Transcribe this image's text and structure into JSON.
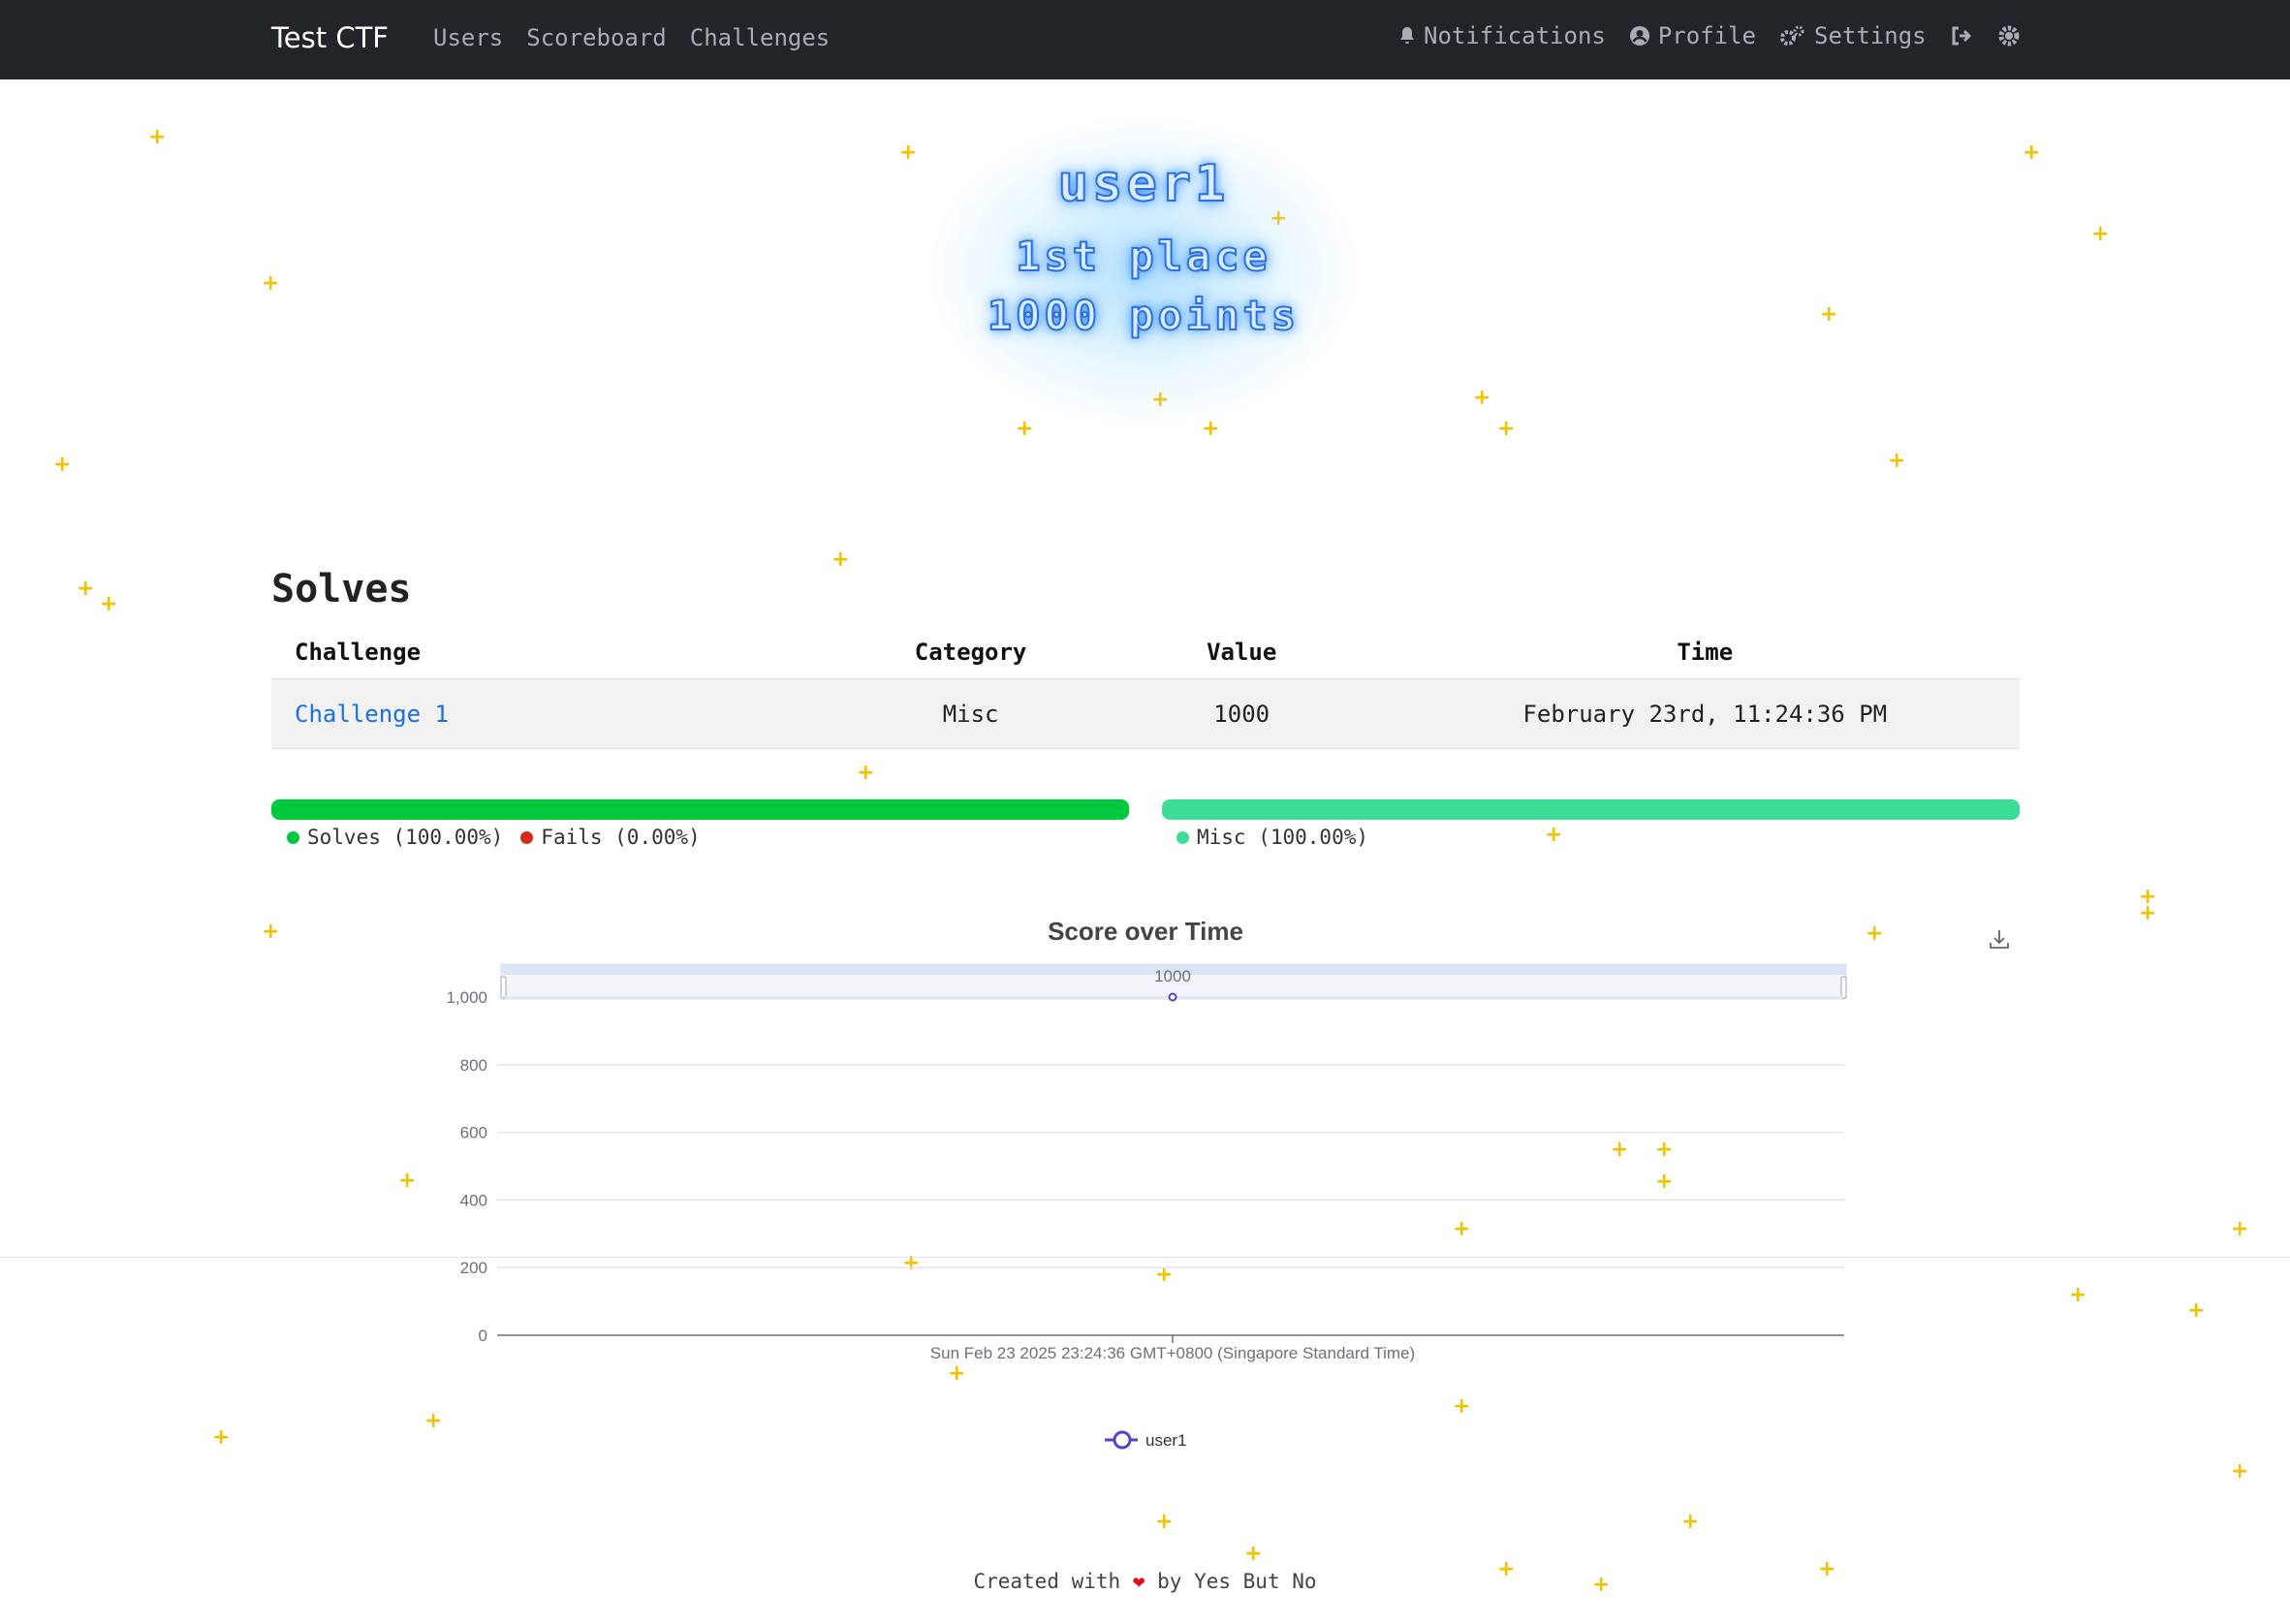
{
  "navbar": {
    "brand": "Test CTF",
    "links": [
      "Users",
      "Scoreboard",
      "Challenges"
    ],
    "right": {
      "notifications": "Notifications",
      "profile": "Profile",
      "settings": "Settings"
    }
  },
  "user": {
    "name": "user1",
    "place": "1st place",
    "points": "1000 points"
  },
  "solves": {
    "title": "Solves",
    "columns": [
      "Challenge",
      "Category",
      "Value",
      "Time"
    ],
    "rows": [
      {
        "challenge": "Challenge 1",
        "category": "Misc",
        "value": "1000",
        "time": "February 23rd, 11:24:36 PM"
      }
    ]
  },
  "solve_stats": {
    "solves": "Solves (100.00%)",
    "fails": "Fails (0.00%)",
    "solves_color": "#00c93e",
    "fails_color": "#d42a1a"
  },
  "category_stats": {
    "misc": "Misc (100.00%)",
    "misc_color": "#3ddc97"
  },
  "chart_data": {
    "type": "line",
    "title": "Score over Time",
    "x": [
      "Sun Feb 23 2025 23:24:36 GMT+0800 (Singapore Standard Time)"
    ],
    "series": [
      {
        "name": "user1",
        "values": [
          1000
        ]
      }
    ],
    "ylim": [
      0,
      1000
    ],
    "yticks": [
      "0",
      "200",
      "400",
      "600",
      "800",
      "1,000"
    ],
    "data_label": "1000",
    "series_color": "#5b3fc4",
    "grid": true,
    "legend": "bottom"
  },
  "footer": {
    "prefix": "Created with",
    "suffix": "by Yes But No"
  }
}
